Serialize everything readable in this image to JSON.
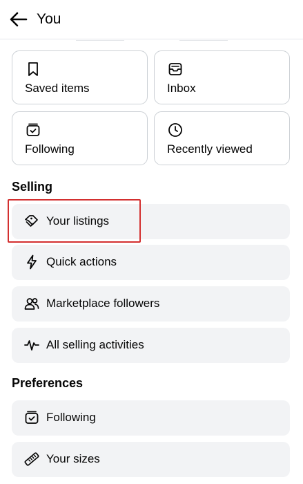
{
  "header": {
    "title": "You",
    "back_icon": "arrow-left-icon"
  },
  "cards": [
    {
      "label": "Saved items",
      "icon": "bookmark-icon"
    },
    {
      "label": "Inbox",
      "icon": "inbox-icon"
    },
    {
      "label": "Following",
      "icon": "following-box-icon"
    },
    {
      "label": "Recently viewed",
      "icon": "clock-icon"
    }
  ],
  "selling": {
    "title": "Selling",
    "items": [
      {
        "label": "Your listings",
        "icon": "tags-icon"
      },
      {
        "label": "Quick actions",
        "icon": "lightning-icon"
      },
      {
        "label": "Marketplace followers",
        "icon": "people-icon"
      },
      {
        "label": "All selling activities",
        "icon": "activity-icon"
      }
    ]
  },
  "preferences": {
    "title": "Preferences",
    "items": [
      {
        "label": "Following",
        "icon": "following-box-icon"
      },
      {
        "label": "Your sizes",
        "icon": "ruler-icon"
      }
    ]
  },
  "colors": {
    "text": "#050505",
    "row_background": "#f2f3f5",
    "card_border": "#ccd0d5",
    "highlight": "#d32f2f"
  }
}
